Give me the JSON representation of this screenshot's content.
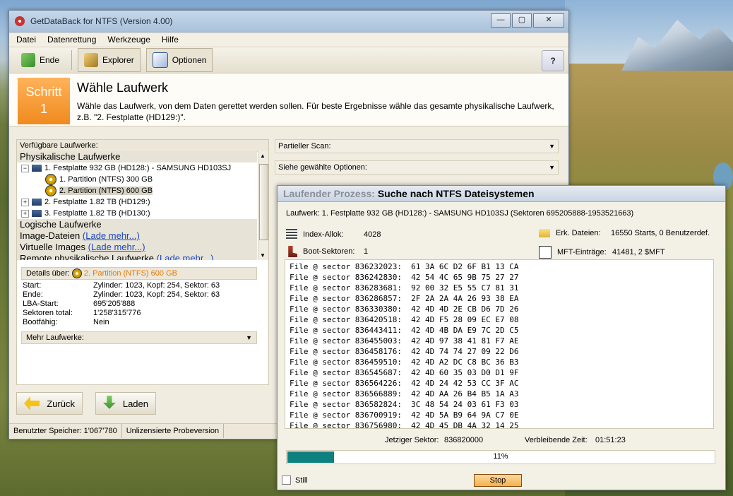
{
  "window": {
    "title": "GetDataBack for NTFS (Version 4.00)",
    "controls": {
      "minimize": "—",
      "maximize": "▢",
      "close": "✕"
    }
  },
  "menu": [
    "Datei",
    "Datenrettung",
    "Werkzeuge",
    "Hilfe"
  ],
  "toolbar": {
    "ende": "Ende",
    "explorer": "Explorer",
    "optionen": "Optionen",
    "help_symbol": "?"
  },
  "step": {
    "label": "Schritt",
    "number": "1",
    "title": "Wähle Laufwerk",
    "description": "Wähle das Laufwerk, von dem Daten gerettet werden sollen. Für beste Ergebnisse wähle das gesamte physikalische Laufwerk, z.B. \"2. Festplatte (HD129:)\"."
  },
  "left_panel": {
    "header": "Verfügbare Laufwerke:",
    "physical_group": "Physikalische Laufwerke",
    "drives": [
      {
        "label": "1. Festplatte 932 GB (HD128:) - SAMSUNG HD103SJ"
      },
      {
        "label": "1. Partition (NTFS) 300 GB"
      },
      {
        "label": "2. Partition (NTFS) 600 GB"
      },
      {
        "label": "2. Festplatte 1.82 TB (HD129:)"
      },
      {
        "label": "3. Festplatte 1.82 TB (HD130:)"
      }
    ],
    "logical_group": "Logische Laufwerke",
    "image_files": "Image-Dateien",
    "image_files_link": "(Lade mehr...)",
    "virtual_images": "Virtuelle Images",
    "virtual_images_link": "(Lade mehr...)",
    "remote_drives": "Remote physikalische Laufwerke",
    "remote_drives_link": "(Lade mehr...)"
  },
  "details": {
    "header_label": "Details über:",
    "header_value": "2. Partition (NTFS) 600 GB",
    "rows": [
      {
        "key": "Start:",
        "value": "Zylinder: 1023, Kopf: 254, Sektor: 63"
      },
      {
        "key": "Ende:",
        "value": "Zylinder: 1023, Kopf: 254, Sektor: 63"
      },
      {
        "key": "LBA-Start:",
        "value": "695'205'888"
      },
      {
        "key": "Sektoren total:",
        "value": "1'258'315'776"
      },
      {
        "key": "Bootfähig:",
        "value": "Nein"
      }
    ],
    "more_drives": "Mehr Laufwerke:"
  },
  "right_panel": {
    "partial_scan": "Partieller Scan:",
    "show_options": "Siehe gewählte Optionen:"
  },
  "nav": {
    "back": "Zurück",
    "load": "Laden"
  },
  "statusbar": {
    "memory": "Benutzter Speicher: 1'067'780",
    "license": "Unlizensierte Probeversion"
  },
  "process": {
    "title_dim": "Laufender Prozess:",
    "title": "Suche nach NTFS Dateisystemen",
    "drive_info": "Laufwerk: 1. Festplatte 932 GB (HD128:) - SAMSUNG HD103SJ (Sektoren 695205888-1953521663)",
    "index_alloc_label": "Index-Allok:",
    "index_alloc_value": "4028",
    "boot_sectors_label": "Boot-Sektoren:",
    "boot_sectors_value": "1",
    "found_files_label": "Erk. Dateien:",
    "found_files_value": "16550 Starts, 0 Benutzerdef.",
    "mft_label": "MFT-Einträge:",
    "mft_value": "41481, 2 $MFT",
    "log_lines": [
      "File @ sector 836232023:  61 3A 6C D2 6F B1 13 CA",
      "File @ sector 836242830:  42 54 4C 65 9B 75 27 27",
      "File @ sector 836283681:  92 00 32 E5 55 C7 81 31",
      "File @ sector 836286857:  2F 2A 2A 4A 26 93 38 EA",
      "File @ sector 836330380:  42 4D 4D 2E CB D6 7D 26",
      "File @ sector 836420518:  42 4D F5 28 09 EC E7 08",
      "File @ sector 836443411:  42 4D 4B DA E9 7C 2D C5",
      "File @ sector 836455003:  42 4D 97 38 41 81 F7 AE",
      "File @ sector 836458176:  42 4D 74 74 27 09 22 D6",
      "File @ sector 836459510:  42 4D A2 DC C8 BC 36 B3",
      "File @ sector 836545687:  42 4D 60 35 03 D0 D1 9F",
      "File @ sector 836564226:  42 4D 24 42 53 CC 3F AC",
      "File @ sector 836566889:  42 4D AA 26 B4 B5 1A A3",
      "File @ sector 836582824:  3C 48 54 24 03 61 F3 03",
      "File @ sector 836700919:  42 4D 5A B9 64 9A C7 0E",
      "File @ sector 836756980:  42 4D 45 DB 4A 32 14 25"
    ],
    "current_sector_label": "Jetziger Sektor:",
    "current_sector_value": "836820000",
    "remaining_time_label": "Verbleibende Zeit:",
    "remaining_time_value": "01:51:23",
    "progress_percent": 11,
    "progress_text": "11%",
    "still_label": "Still",
    "stop_button": "Stop"
  },
  "colors": {
    "step_orange": "#f08a1e",
    "progress_teal": "#0f8080",
    "link_blue": "#1a47c3",
    "details_value_orange": "#e57a0b"
  }
}
